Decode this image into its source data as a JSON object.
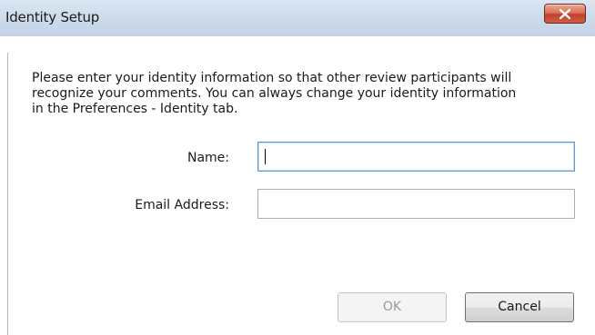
{
  "window": {
    "title": "Identity Setup",
    "close_icon": "close-x-icon"
  },
  "dialog": {
    "message": "Please enter your identity information so that other review participants will\nrecognize your comments. You can always change your identity information\nin the Preferences - Identity tab.",
    "name_label": "Name:",
    "name_value": "",
    "email_label": "Email Address:",
    "email_value": "",
    "ok_label": "OK",
    "ok_enabled": false,
    "cancel_label": "Cancel"
  },
  "colors": {
    "titlebar": "#cddbeb",
    "close_button": "#c1402a",
    "focus_border": "#5b9bd5"
  }
}
